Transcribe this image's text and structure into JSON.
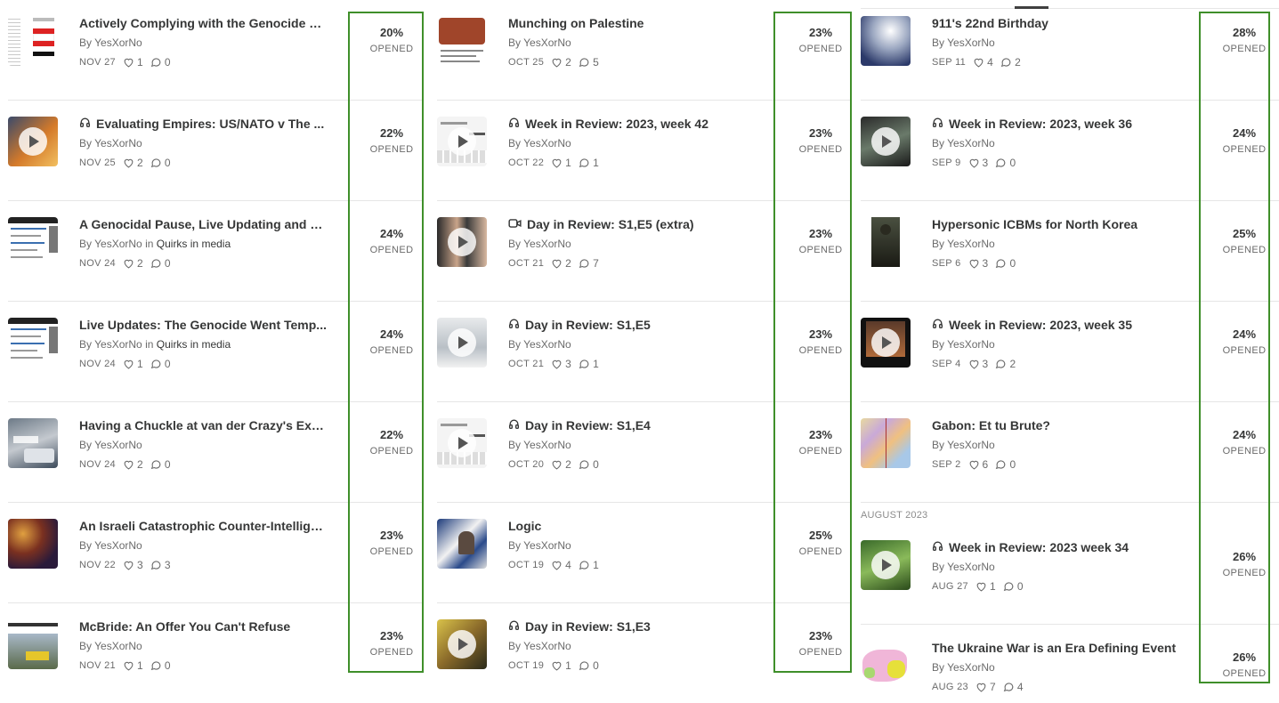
{
  "columns": [
    {
      "items": [
        {
          "title": "Actively Complying with the Genocide C...",
          "type": "text",
          "author": "YesXorNo",
          "publication": "",
          "date": "NOV 27",
          "likes": "1",
          "comments": "0",
          "percent": "20%",
          "percent_label": "OPENED",
          "thumb": "flag"
        },
        {
          "title": "Evaluating Empires: US/NATO v The ...",
          "type": "audio",
          "author": "YesXorNo",
          "publication": "",
          "date": "NOV 25",
          "likes": "2",
          "comments": "0",
          "percent": "22%",
          "percent_label": "OPENED",
          "thumb": "fire"
        },
        {
          "title": "A Genocidal Pause, Live Updating and a...",
          "type": "text",
          "author": "YesXorNo",
          "publication": "Quirks in media",
          "date": "NOV 24",
          "likes": "2",
          "comments": "0",
          "percent": "24%",
          "percent_label": "OPENED",
          "thumb": "news"
        },
        {
          "title": "Live Updates: The Genocide Went Temp...",
          "type": "text",
          "author": "YesXorNo",
          "publication": "Quirks in media",
          "date": "NOV 24",
          "likes": "1",
          "comments": "0",
          "percent": "24%",
          "percent_label": "OPENED",
          "thumb": "news"
        },
        {
          "title": "Having a Chuckle at van der Crazy's Exp...",
          "type": "text",
          "author": "YesXorNo",
          "publication": "",
          "date": "NOV 24",
          "likes": "2",
          "comments": "0",
          "percent": "22%",
          "percent_label": "OPENED",
          "thumb": "street"
        },
        {
          "title": "An Israeli Catastrophic Counter-Intellige...",
          "type": "text",
          "author": "YesXorNo",
          "publication": "",
          "date": "NOV 22",
          "likes": "3",
          "comments": "3",
          "percent": "23%",
          "percent_label": "OPENED",
          "thumb": "collage"
        },
        {
          "title": "McBride: An Offer You Can't Refuse",
          "type": "text",
          "author": "YesXorNo",
          "publication": "",
          "date": "NOV 21",
          "likes": "1",
          "comments": "0",
          "percent": "23%",
          "percent_label": "OPENED",
          "thumb": "protest"
        }
      ]
    },
    {
      "items": [
        {
          "title": "Munching on Palestine",
          "type": "text",
          "author": "YesXorNo",
          "publication": "",
          "date": "OCT 25",
          "likes": "2",
          "comments": "5",
          "percent": "23%",
          "percent_label": "OPENED",
          "thumb": "brown"
        },
        {
          "title": "Week in Review: 2023, week 42",
          "type": "audio",
          "author": "YesXorNo",
          "publication": "",
          "date": "OCT 22",
          "likes": "1",
          "comments": "1",
          "percent": "23%",
          "percent_label": "OPENED",
          "thumb": "doc"
        },
        {
          "title": "Day in Review: S1,E5 (extra)",
          "type": "video",
          "author": "YesXorNo",
          "publication": "",
          "date": "OCT 21",
          "likes": "2",
          "comments": "7",
          "percent": "23%",
          "percent_label": "OPENED",
          "thumb": "people"
        },
        {
          "title": "Day in Review: S1,E5",
          "type": "audio",
          "author": "YesXorNo",
          "publication": "",
          "date": "OCT 21",
          "likes": "3",
          "comments": "1",
          "percent": "23%",
          "percent_label": "OPENED",
          "thumb": "grey"
        },
        {
          "title": "Day in Review: S1,E4",
          "type": "audio",
          "author": "YesXorNo",
          "publication": "",
          "date": "OCT 20",
          "likes": "2",
          "comments": "0",
          "percent": "23%",
          "percent_label": "OPENED",
          "thumb": "doc"
        },
        {
          "title": "Logic",
          "type": "text",
          "author": "YesXorNo",
          "publication": "",
          "date": "OCT 19",
          "likes": "4",
          "comments": "1",
          "percent": "25%",
          "percent_label": "OPENED",
          "thumb": "tv"
        },
        {
          "title": "Day in Review: S1,E3",
          "type": "audio",
          "author": "YesXorNo",
          "publication": "",
          "date": "OCT 19",
          "likes": "1",
          "comments": "0",
          "percent": "23%",
          "percent_label": "OPENED",
          "thumb": "poster"
        }
      ]
    },
    {
      "section_label": "AUGUST 2023",
      "items": [
        {
          "title": "911's 22nd Birthday",
          "type": "text",
          "author": "YesXorNo",
          "publication": "",
          "date": "SEP 11",
          "likes": "4",
          "comments": "2",
          "percent": "28%",
          "percent_label": "OPENED",
          "thumb": "sky"
        },
        {
          "title": "Week in Review: 2023, week 36",
          "type": "audio",
          "author": "YesXorNo",
          "publication": "",
          "date": "SEP 9",
          "likes": "3",
          "comments": "0",
          "percent": "24%",
          "percent_label": "OPENED",
          "thumb": "dark"
        },
        {
          "title": "Hypersonic ICBMs for North Korea",
          "type": "text",
          "author": "YesXorNo",
          "publication": "",
          "date": "SEP 6",
          "likes": "3",
          "comments": "0",
          "percent": "25%",
          "percent_label": "OPENED",
          "thumb": "figure"
        },
        {
          "title": "Week in Review: 2023, week 35",
          "type": "audio",
          "author": "YesXorNo",
          "publication": "",
          "date": "SEP 4",
          "likes": "3",
          "comments": "2",
          "percent": "24%",
          "percent_label": "OPENED",
          "thumb": "darkvid"
        },
        {
          "title": "Gabon: Et tu Brute?",
          "type": "text",
          "author": "YesXorNo",
          "publication": "",
          "date": "SEP 2",
          "likes": "6",
          "comments": "0",
          "percent": "24%",
          "percent_label": "OPENED",
          "thumb": "map"
        },
        {
          "title": "Week in Review: 2023 week 34",
          "type": "audio",
          "author": "YesXorNo",
          "publication": "",
          "date": "AUG 27",
          "likes": "1",
          "comments": "0",
          "percent": "26%",
          "percent_label": "OPENED",
          "thumb": "green"
        },
        {
          "title": "The Ukraine War is an Era Defining Event",
          "type": "text",
          "author": "YesXorNo",
          "publication": "",
          "date": "AUG 23",
          "likes": "7",
          "comments": "4",
          "percent": "26%",
          "percent_label": "OPENED",
          "thumb": "ukmap"
        }
      ]
    }
  ],
  "by_prefix": "By",
  "in_word": "in",
  "colors": {
    "highlight": "#3f8f2a",
    "text": "#363737",
    "muted": "#6b6b6b",
    "divider": "#e6e6e6"
  }
}
